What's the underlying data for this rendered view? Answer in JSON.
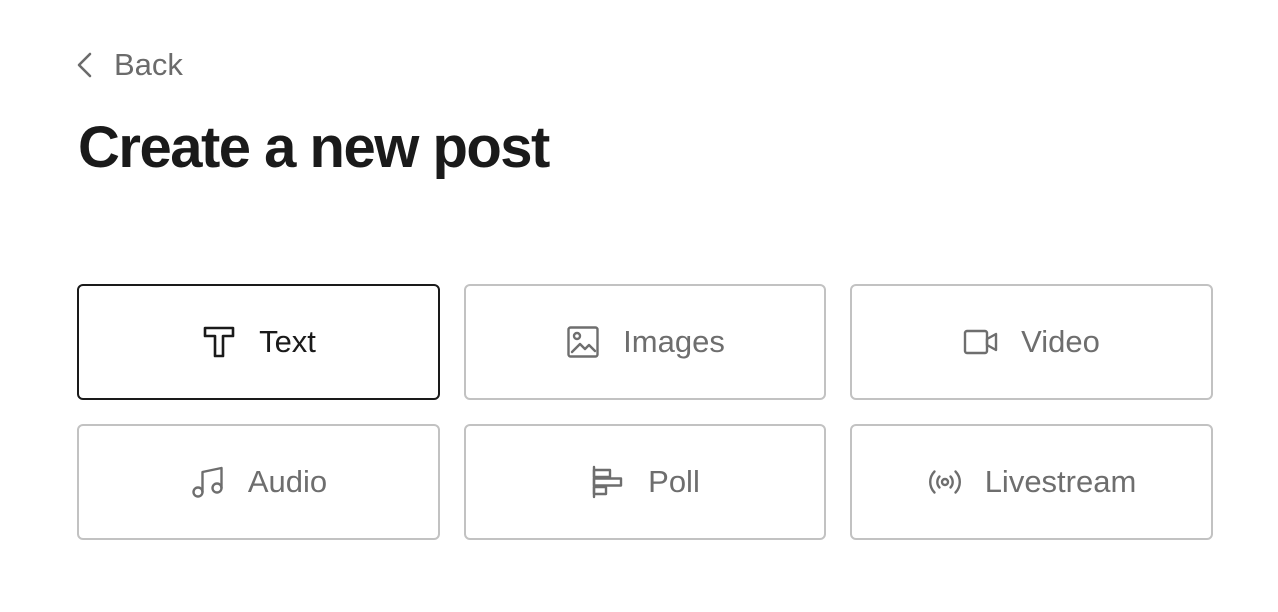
{
  "back": {
    "label": "Back",
    "icon": "chevron-left-icon"
  },
  "page": {
    "title": "Create a new post"
  },
  "options": [
    {
      "label": "Text",
      "icon": "text-icon",
      "selected": true
    },
    {
      "label": "Images",
      "icon": "image-icon",
      "selected": false
    },
    {
      "label": "Video",
      "icon": "video-icon",
      "selected": false
    },
    {
      "label": "Audio",
      "icon": "music-note-icon",
      "selected": false
    },
    {
      "label": "Poll",
      "icon": "poll-icon",
      "selected": false
    },
    {
      "label": "Livestream",
      "icon": "livestream-icon",
      "selected": false
    }
  ],
  "colors": {
    "text_primary": "#1a1a1a",
    "text_muted": "#6e6e6e",
    "border": "#c2c2c2",
    "selected_border": "#1a1a1a"
  }
}
